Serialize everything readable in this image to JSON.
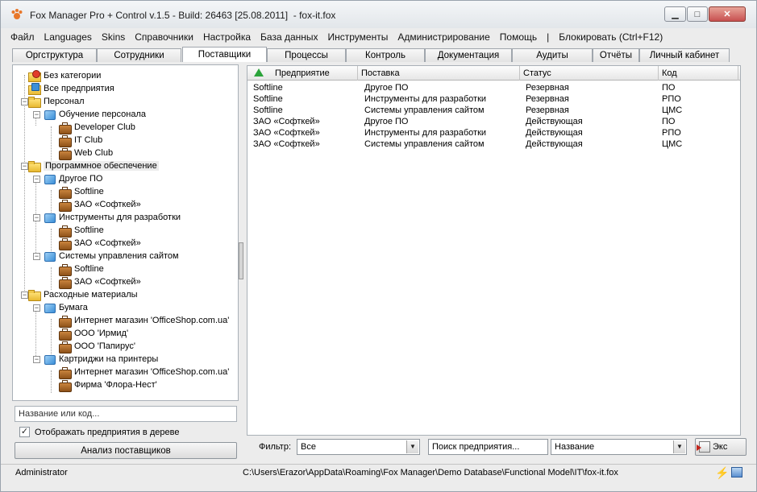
{
  "window": {
    "title": "Fox Manager Pro + Control v.1.5 - Build: 26463 [25.08.2011]  - fox-it.fox",
    "min_label": "▁",
    "max_label": "□",
    "close_label": "✕"
  },
  "menu": [
    "Файл",
    "Languages",
    "Skins",
    "Справочники",
    "Настройка",
    "База данных",
    "Инструменты",
    "Администрирование",
    "Помощь",
    "|",
    "Блокировать (Ctrl+F12)"
  ],
  "tabs": [
    "Оргструктура",
    "Сотрудники",
    "Поставщики",
    "Процессы",
    "Контроль",
    "Документация",
    "Аудиты",
    "Отчёты",
    "Личный кабинет"
  ],
  "active_tab": "Поставщики",
  "tree": [
    {
      "label": "Без категории",
      "icon": "nocat-icon"
    },
    {
      "label": "Все предприятия",
      "icon": "all-icon"
    },
    {
      "label": "Персонал",
      "icon": "folder-icon"
    },
    {
      "label": "Обучение персонала",
      "icon": "cube-icon"
    },
    {
      "label": "Developer Club",
      "icon": "briefcase-icon"
    },
    {
      "label": "IT Club",
      "icon": "briefcase-icon"
    },
    {
      "label": "Web Club",
      "icon": "briefcase-icon"
    },
    {
      "label": "Программное обеспечение",
      "icon": "folder-icon",
      "selected": true
    },
    {
      "label": "Другое ПО",
      "icon": "cube-icon"
    },
    {
      "label": "Softline",
      "icon": "briefcase-icon"
    },
    {
      "label": "ЗАО «Софткей»",
      "icon": "briefcase-icon"
    },
    {
      "label": "Инструменты для разработки",
      "icon": "cube-icon"
    },
    {
      "label": "Softline",
      "icon": "briefcase-icon"
    },
    {
      "label": "ЗАО «Софткей»",
      "icon": "briefcase-icon"
    },
    {
      "label": "Системы управления сайтом",
      "icon": "cube-icon"
    },
    {
      "label": "Softline",
      "icon": "briefcase-icon"
    },
    {
      "label": "ЗАО «Софткей»",
      "icon": "briefcase-icon"
    },
    {
      "label": "Расходные материалы",
      "icon": "folder-icon"
    },
    {
      "label": "Бумага",
      "icon": "cube-icon"
    },
    {
      "label": "Интернет магазин 'OfficeShop.com.ua'",
      "icon": "briefcase-icon"
    },
    {
      "label": "ООО 'Ирмид'",
      "icon": "briefcase-icon"
    },
    {
      "label": "ООО 'Папирус'",
      "icon": "briefcase-icon"
    },
    {
      "label": "Картриджи на принтеры",
      "icon": "cube-icon"
    },
    {
      "label": "Интернет магазин 'OfficeShop.com.ua'",
      "icon": "briefcase-icon"
    },
    {
      "label": "Фирма 'Флора-Нест'",
      "icon": "briefcase-icon"
    }
  ],
  "left": {
    "search_text": "Название или код...",
    "show_in_tree_label": "Отображать предприятия в дереве",
    "show_in_tree_checked": true,
    "check_mark": "✓",
    "analyze_button": "Анализ поставщиков"
  },
  "grid": {
    "columns": [
      "Предприятие",
      "Поставка",
      "Статус",
      "Код"
    ],
    "rows": [
      [
        "Softline",
        "Другое ПО",
        "Резервная",
        "ПО"
      ],
      [
        "Softline",
        "Инструменты для разработки",
        "Резервная",
        "РПО"
      ],
      [
        "Softline",
        "Системы управления сайтом",
        "Резервная",
        "ЦМС"
      ],
      [
        "ЗАО «Софткей»",
        "Другое ПО",
        "Действующая",
        "ПО"
      ],
      [
        "ЗАО «Софткей»",
        "Инструменты для разработки",
        "Действующая",
        "РПО"
      ],
      [
        "ЗАО «Софткей»",
        "Системы управления сайтом",
        "Действующая",
        "ЦМС"
      ]
    ]
  },
  "filter": {
    "label": "Фильтр:",
    "value": "Все",
    "search_placeholder": "Поиск предприятия...",
    "field_value": "Название",
    "export_label": "Экс",
    "arrow": "▼"
  },
  "status": {
    "user": "Administrator",
    "path": "C:\\Users\\Erazor\\AppData\\Roaming\\Fox Manager\\Demo Database\\Functional Model\\IT\\fox-it.fox",
    "bolt": "⚡"
  }
}
